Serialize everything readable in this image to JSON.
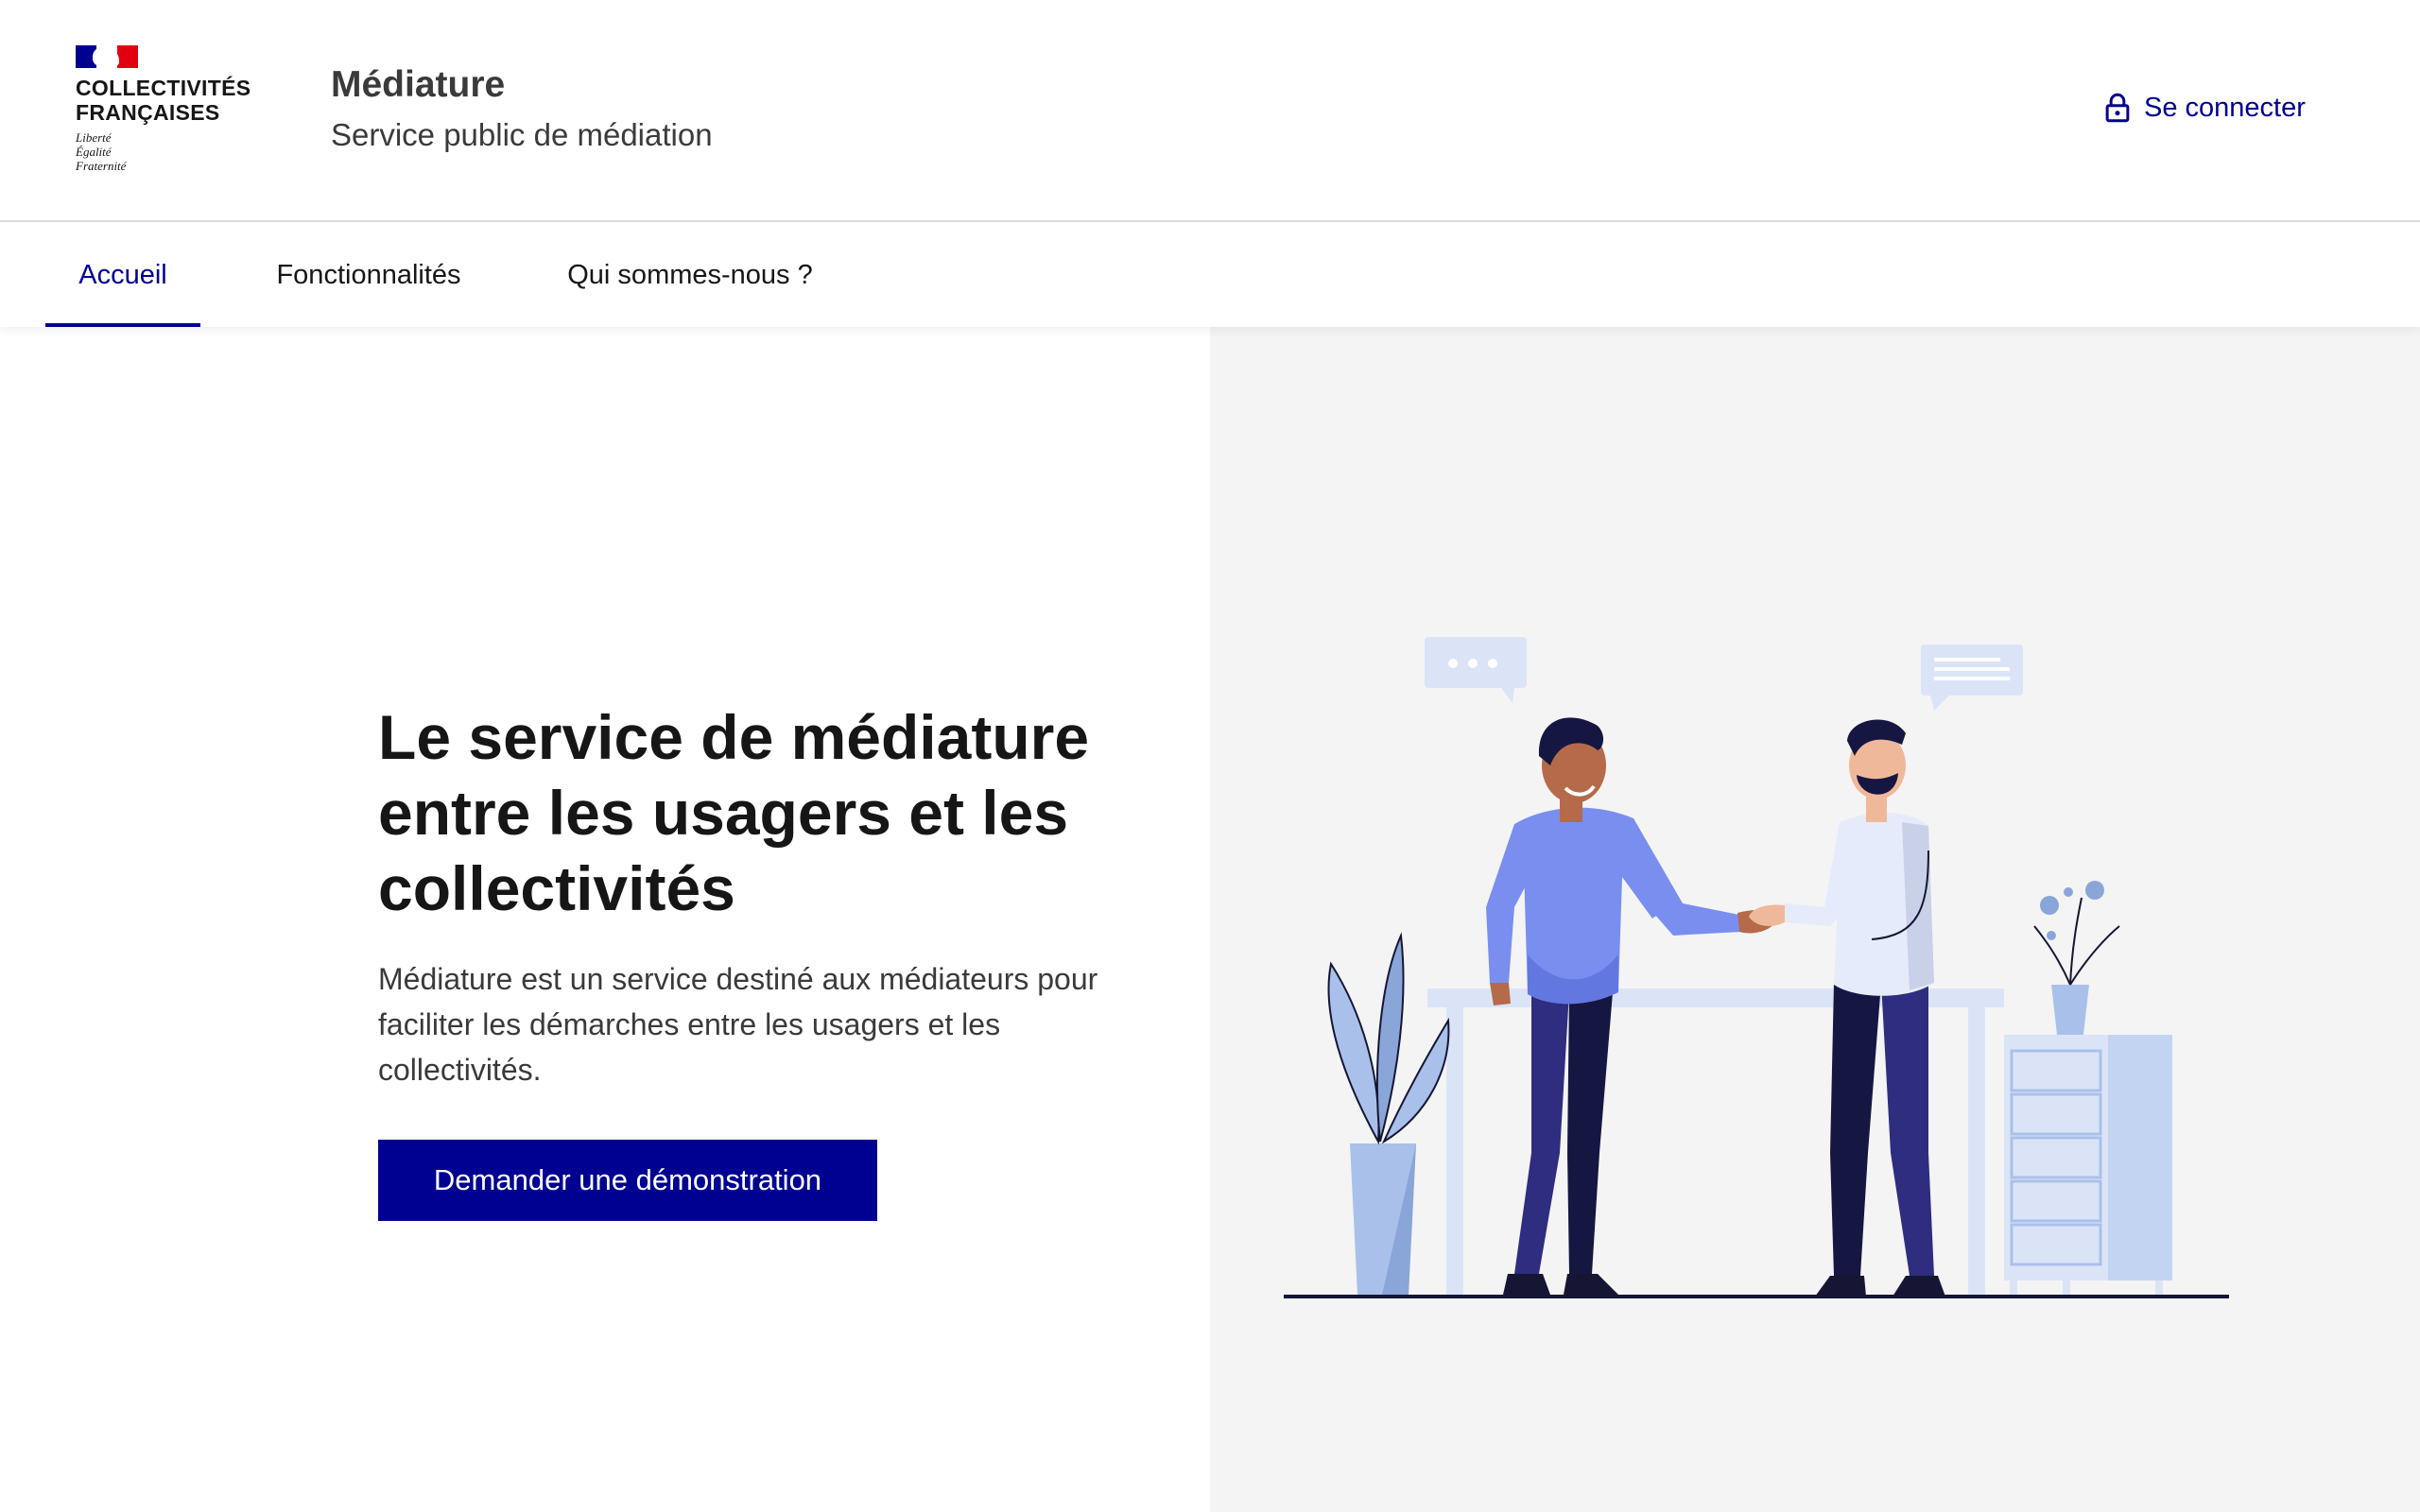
{
  "header": {
    "org_name": "COLLECTIVITÉS\nFRANÇAISES",
    "motto": "Liberté\nÉgalité\nFraternité",
    "service_title": "Médiature",
    "service_tagline": "Service public de médiation",
    "login_label": "Se connecter",
    "login_icon": "lock-icon"
  },
  "nav": {
    "items": [
      {
        "label": "Accueil",
        "active": true
      },
      {
        "label": "Fonctionnalités",
        "active": false
      },
      {
        "label": "Qui sommes-nous ?",
        "active": false
      }
    ]
  },
  "hero": {
    "title": "Le service de médiature entre les usagers et les collectivités",
    "description": "Médiature est un service destiné aux médiateurs pour faciliter les démarches entre les usagers et les collectivités.",
    "cta_label": "Demander une démonstration",
    "illustration": "handshake-illustration"
  },
  "colors": {
    "primary": "#000091",
    "flag_red": "#e1000f",
    "panel_bg": "#f4f4f4",
    "text": "#161616"
  }
}
